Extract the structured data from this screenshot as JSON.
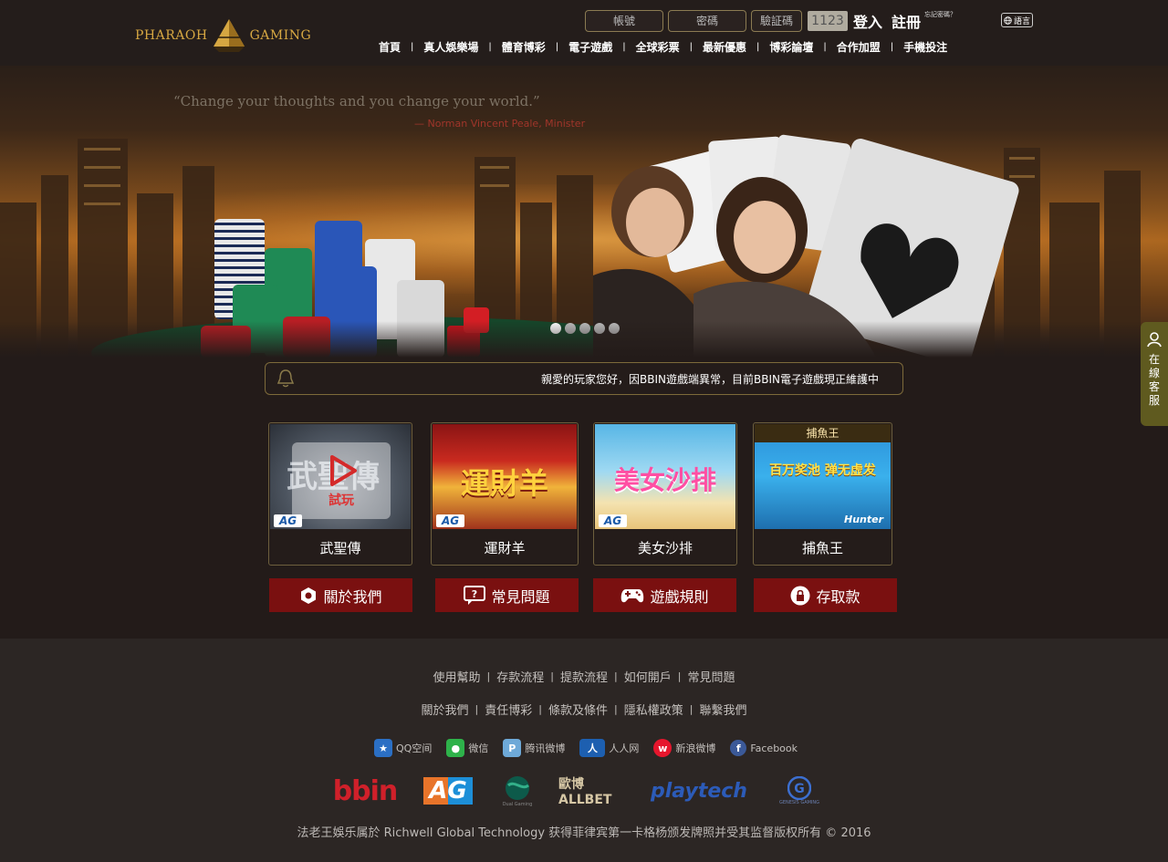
{
  "brand": {
    "name_left": "PHARAOH",
    "name_right": "GAMING"
  },
  "login": {
    "account_placeholder": "帳號",
    "password_placeholder": "密碼",
    "captcha_placeholder": "驗証碼",
    "captcha_code": "1123",
    "login_label": "登入",
    "register_label": "註冊",
    "forgot_label": "忘記密碼？",
    "language_label": "語言"
  },
  "nav": {
    "items": [
      "首頁",
      "真人娛樂場",
      "體育博彩",
      "電子遊戲",
      "全球彩票",
      "最新優惠",
      "博彩論壇",
      "合作加盟",
      "手機投注"
    ]
  },
  "banner": {
    "quote": "“Change your thoughts and you change your world.”",
    "author": "— Norman Vincent Peale, Minister",
    "slides": 5,
    "active_slide": 1
  },
  "side_service": {
    "label": "在線客服"
  },
  "notice": {
    "message": "親愛的玩家您好，因BBIN遊戲端異常，目前BBIN電子遊戲現正維護中"
  },
  "games": {
    "items": [
      {
        "name": "武聖傳",
        "thumb_text": "武聖傳",
        "provider": "AG",
        "overlay": "試玩"
      },
      {
        "name": "運財羊",
        "thumb_text": "運財羊",
        "provider": "AG"
      },
      {
        "name": "美女沙排",
        "thumb_text": "美女沙排",
        "provider": "AG"
      },
      {
        "name": "捕魚王",
        "thumb_text": "捕魚王",
        "thumb_sub": "百万奖池 弹无虚发",
        "provider": "Hunter"
      }
    ]
  },
  "actions": {
    "items": [
      "關於我們",
      "常見問題",
      "遊戲規則",
      "存取款"
    ]
  },
  "footer": {
    "row1": [
      "使用幫助",
      "存款流程",
      "提款流程",
      "如何開戶",
      "常見問題"
    ],
    "row2": [
      "關於我們",
      "責任博彩",
      "條款及條件",
      "隱私權政策",
      "聯繫我們"
    ],
    "social": [
      "QQ空间",
      "微信",
      "腾讯微博",
      "人人网",
      "新浪微博",
      "Facebook"
    ],
    "partners": [
      "bbin",
      "AG",
      "Dual Gaming",
      "歐博 ALLBET",
      "playtech",
      "GENESIS GAMING"
    ],
    "copyright": "法老王娛乐属於 Richwell Global Technology 获得菲律宾第一卡格杨颁发牌照并受其监督版权所有 © 2016"
  },
  "colors": {
    "page_bg": "#231b19",
    "footer_bg": "#2c2624",
    "action_red": "#7a1010",
    "gold_border": "#7d6a3a",
    "service_tab": "#5f5a1f"
  }
}
